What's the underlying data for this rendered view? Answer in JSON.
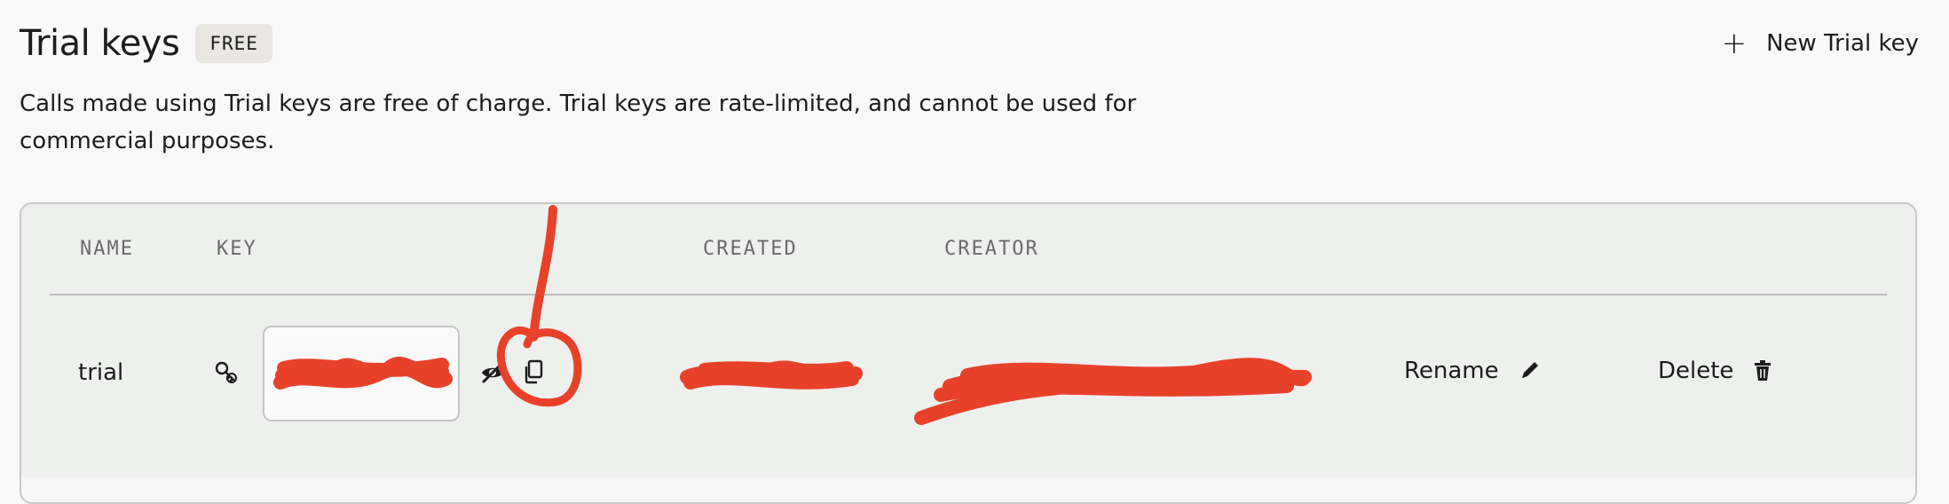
{
  "header": {
    "title": "Trial keys",
    "badge": "FREE",
    "new_key_label": "New Trial key",
    "description": "Calls made using Trial keys are free of charge. Trial keys are rate-limited, and cannot be used for commercial purposes."
  },
  "table": {
    "columns": [
      "NAME",
      "KEY",
      "CREATED",
      "CREATOR"
    ],
    "rows": [
      {
        "name": "trial",
        "rename_label": "Rename",
        "delete_label": "Delete"
      }
    ]
  },
  "icons": {
    "key_icon": "key-search-icon",
    "reveal_icon": "eye-off-icon",
    "copy_icon": "copy-icon",
    "rename_icon": "pencil-icon",
    "delete_icon": "trash-icon"
  },
  "colors": {
    "redaction": "#e8412a",
    "annotation": "#e8412a",
    "badge_bg": "#e9e7e1",
    "table_bg": "#eef0ee"
  }
}
